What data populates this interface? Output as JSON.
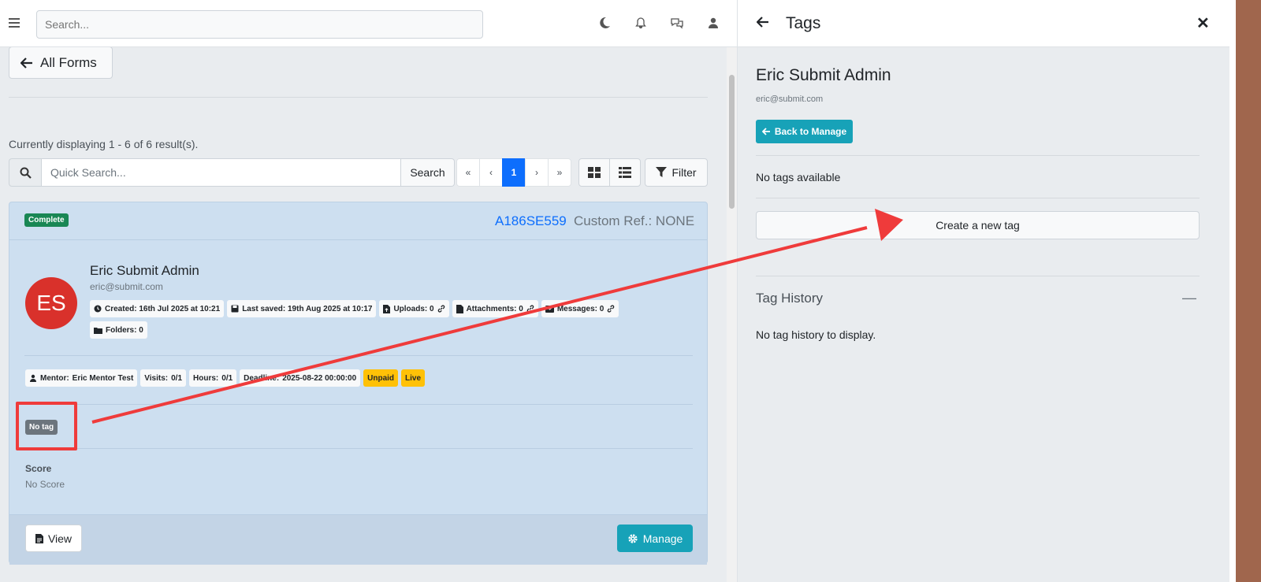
{
  "topnav": {
    "search_placeholder": "Search...",
    "icons": [
      "menu-icon",
      "moon-icon",
      "bell-icon",
      "chat-icon",
      "user-icon"
    ]
  },
  "left": {
    "back_label": "All Forms",
    "displaying": "Currently displaying 1 - 6 of 6 result(s).",
    "quick_search_placeholder": "Quick Search...",
    "search_button": "Search",
    "pager": [
      "«",
      "‹",
      "1",
      "›",
      "»"
    ],
    "filter_label": "Filter"
  },
  "card": {
    "status": "Complete",
    "ref": "A186SE559",
    "custom_ref": "Custom Ref.: NONE",
    "avatar_initials": "ES",
    "name": "Eric Submit Admin",
    "email": "eric@submit.com",
    "meta": {
      "created": "Created: 16th Jul 2025 at 10:21",
      "last_saved": "Last saved: 19th Aug 2025 at 10:17",
      "uploads": "Uploads: 0",
      "attachments": "Attachments: 0",
      "messages": "Messages: 0",
      "folders": "Folders: 0"
    },
    "details": {
      "mentor_label": "Mentor:",
      "mentor": "Eric Mentor Test",
      "visits_label": "Visits:",
      "visits": "0/1",
      "hours_label": "Hours:",
      "hours": "0/1",
      "deadline_label": "Deadline:",
      "deadline": "2025-08-22 00:00:00",
      "unpaid": "Unpaid",
      "live": "Live"
    },
    "tag": "No tag",
    "score_label": "Score",
    "score_value": "No Score",
    "view_label": "View",
    "manage_label": "Manage"
  },
  "panel": {
    "title": "Tags",
    "name": "Eric Submit Admin",
    "email": "eric@submit.com",
    "back_to_manage": "Back to Manage",
    "no_tags": "No tags available",
    "create_tag": "Create a new tag",
    "tag_history": "Tag History",
    "no_history": "No tag history to display."
  },
  "colors": {
    "primary": "#0d6efd",
    "info": "#17a2b8",
    "success": "#198754",
    "warning": "#ffc107",
    "secondary": "#6c757d",
    "avatar": "#d9312b",
    "annotation": "#ef3b3b",
    "card_bg": "#cddff0"
  }
}
